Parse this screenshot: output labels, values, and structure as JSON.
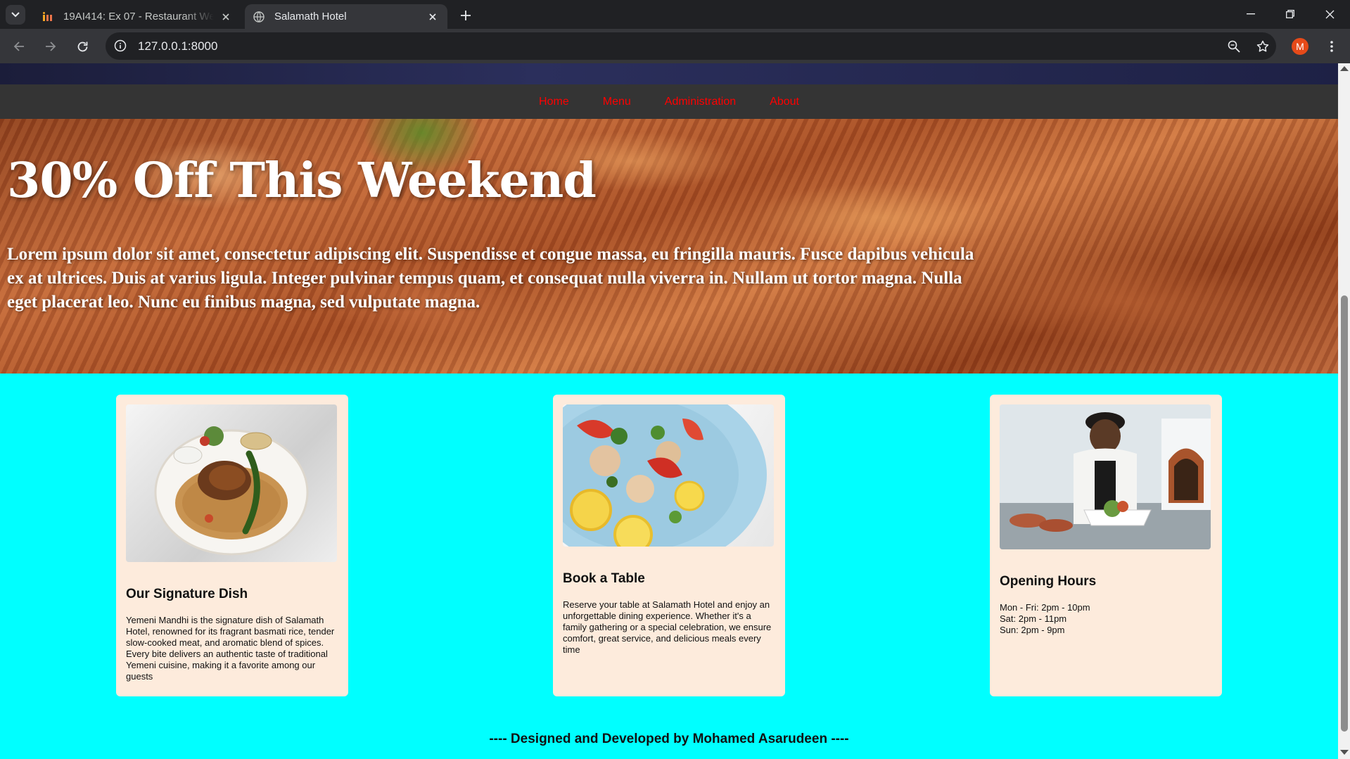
{
  "browser": {
    "tabs": [
      {
        "title": "19AI414: Ex 07 - Restaurant Website",
        "active": false,
        "favicon": "invision-icon"
      },
      {
        "title": "Salamath Hotel",
        "active": true,
        "favicon": "globe-icon"
      }
    ],
    "url": "127.0.0.1:8000",
    "profile_initial": "M",
    "profile_color": "#e64a19"
  },
  "nav": {
    "items": [
      "Home",
      "Menu",
      "Administration",
      "About"
    ],
    "link_color": "#ff0000"
  },
  "hero": {
    "title": "30% Off This Weekend",
    "text": "Lorem ipsum dolor sit amet, consectetur adipiscing elit. Suspendisse et congue massa, eu fringilla mauris. Fusce dapibus vehicula ex at ultrices. Duis at varius ligula. Integer pulvinar tempus quam, et consequat nulla viverra in. Nullam ut tortor magna. Nulla eget placerat leo. Nunc eu finibus magna, sed vulputate magna."
  },
  "cards": [
    {
      "title": "Our Signature Dish",
      "body": "Yemeni Mandhi is the signature dish of Salamath Hotel, renowned for its fragrant basmati rice, tender slow-cooked meat, and aromatic blend of spices. Every bite delivers an authentic taste of traditional Yemeni cuisine, making it a favorite among our guests"
    },
    {
      "title": "Book a Table",
      "body": "Reserve your table at Salamath Hotel and enjoy an unforgettable dining experience. Whether it's a family gathering or a special celebration, we ensure comfort, great service, and delicious meals every time"
    },
    {
      "title": "Opening Hours",
      "hours": [
        "Mon - Fri: 2pm - 10pm",
        "Sat: 2pm - 11pm",
        "Sun: 2pm - 9pm"
      ]
    }
  ],
  "footer": "---- Designed and Developed by Mohamed Asarudeen ----",
  "colors": {
    "page_background": "#00ffff",
    "card_background": "#fdebdc",
    "navbar_background": "#343434"
  }
}
